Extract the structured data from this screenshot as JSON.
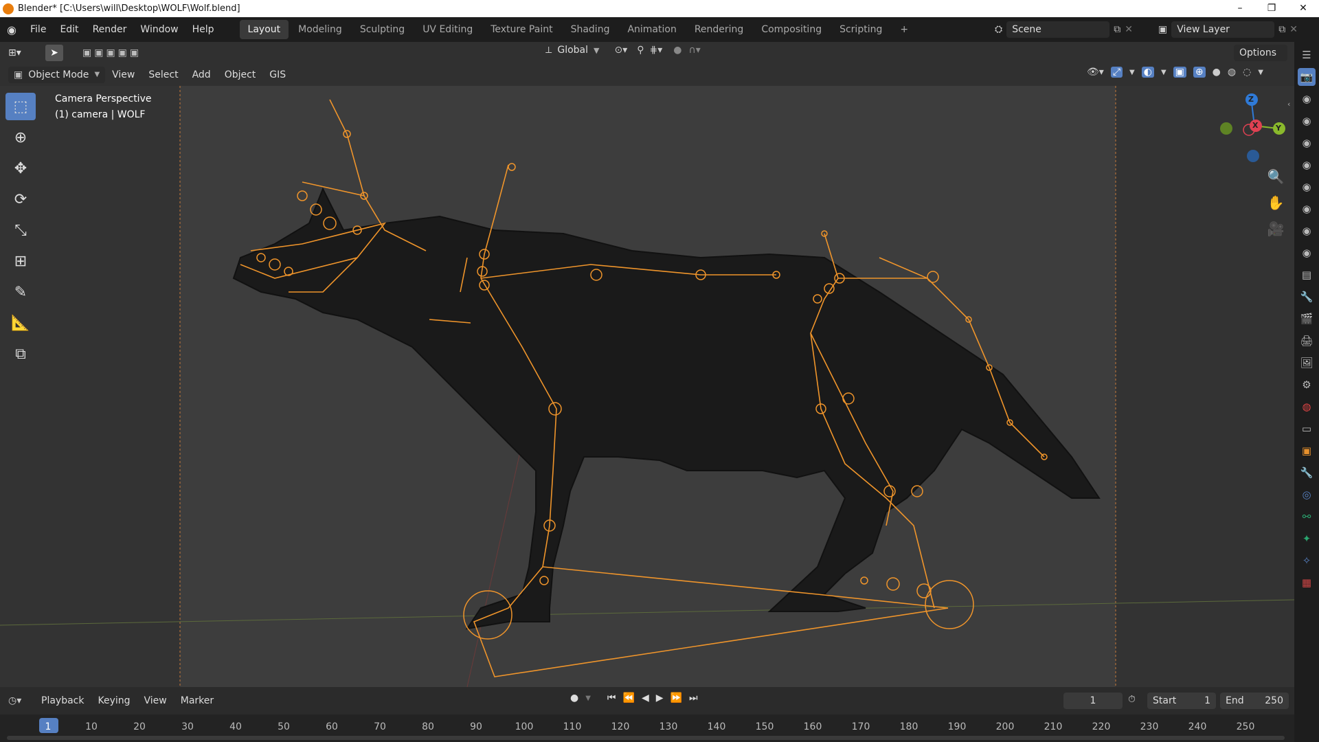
{
  "window": {
    "title": "Blender* [C:\\Users\\will\\Desktop\\WOLF\\Wolf.blend]",
    "minimize": "–",
    "maximize": "❐",
    "close": "✕"
  },
  "menu": [
    "File",
    "Edit",
    "Render",
    "Window",
    "Help"
  ],
  "workspaces": [
    "Layout",
    "Modeling",
    "Sculpting",
    "UV Editing",
    "Texture Paint",
    "Shading",
    "Animation",
    "Rendering",
    "Compositing",
    "Scripting"
  ],
  "add_workspace": "+",
  "scene": {
    "label": "Scene"
  },
  "view_layer": {
    "label": "View Layer"
  },
  "tool_settings": {
    "orientation": "Global",
    "options": "Options"
  },
  "viewport_header": {
    "mode": "Object Mode",
    "menus": [
      "View",
      "Select",
      "Add",
      "Object",
      "GIS"
    ]
  },
  "viewport": {
    "line1": "Camera Perspective",
    "line2": "(1) camera | WOLF"
  },
  "gizmo": {
    "x": "X",
    "y": "Y",
    "z": "Z"
  },
  "timeline": {
    "menus": [
      "Playback",
      "Keying",
      "View",
      "Marker"
    ],
    "current_frame": "1",
    "start_label": "Start",
    "start_value": "1",
    "end_label": "End",
    "end_value": "250",
    "ruler": [
      "1",
      "10",
      "20",
      "30",
      "40",
      "50",
      "60",
      "70",
      "80",
      "90",
      "100",
      "110",
      "120",
      "130",
      "140",
      "150",
      "160",
      "170",
      "180",
      "190",
      "200",
      "210",
      "220",
      "230",
      "240",
      "250"
    ]
  },
  "colors": {
    "accent": "#5680c2",
    "armature": "#f0952b",
    "active_tab": "#3a3a3a"
  }
}
